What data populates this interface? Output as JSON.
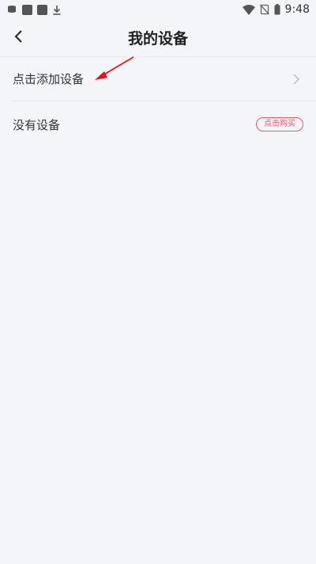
{
  "status_bar": {
    "time": "9:48",
    "left_icons": [
      "notification-icon",
      "app-icon",
      "app-icon",
      "download-icon"
    ],
    "right_icons": [
      "wifi-icon",
      "no-sim-icon",
      "battery-icon"
    ]
  },
  "header": {
    "title": "我的设备",
    "back_icon": "chevron-left-icon"
  },
  "rows": {
    "add_device": {
      "label": "点击添加设备",
      "icon": "chevron-right-icon"
    },
    "no_device": {
      "label": "没有设备",
      "buy_label": "点击购买"
    }
  },
  "colors": {
    "background": "#f4f5f9",
    "accent": "#e85a6d",
    "annotation_arrow": "#e8101b"
  }
}
